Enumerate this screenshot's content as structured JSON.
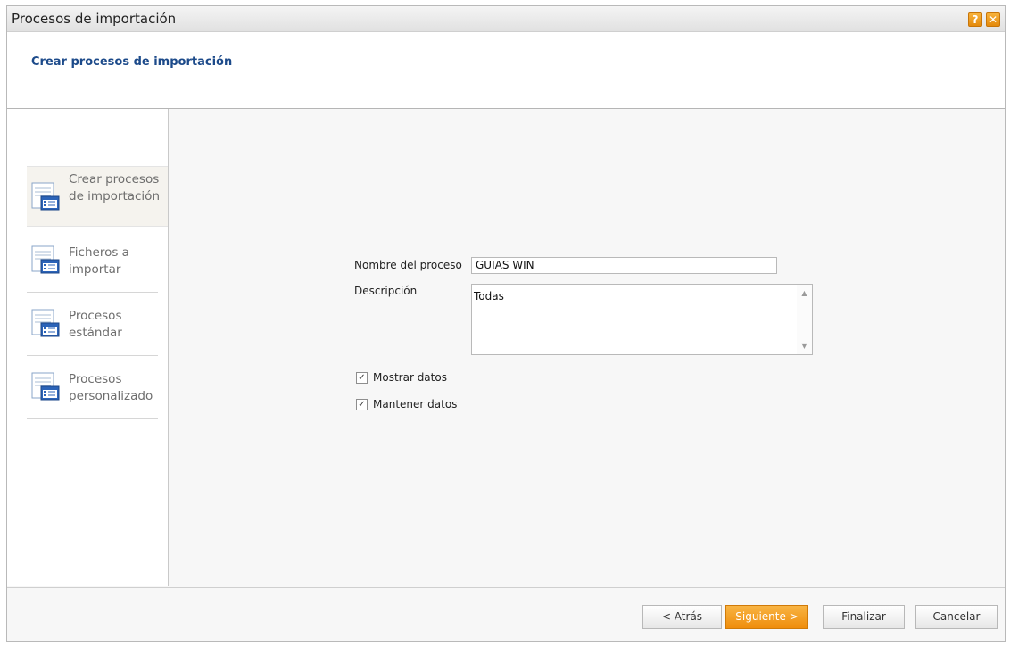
{
  "window": {
    "title": "Procesos de importación",
    "help_icon": "help-icon",
    "close_icon": "close-icon"
  },
  "header": {
    "subtitle": "Crear procesos de importación"
  },
  "sidebar": {
    "items": [
      {
        "label": "Crear procesos de importación",
        "icon": "form-list-icon",
        "active": true
      },
      {
        "label": "Ficheros a importar",
        "icon": "form-list-icon",
        "active": false
      },
      {
        "label": "Procesos estándar",
        "icon": "form-list-icon",
        "active": false
      },
      {
        "label": "Procesos personalizado",
        "icon": "form-list-icon",
        "active": false
      }
    ]
  },
  "form": {
    "name_label": "Nombre del proceso",
    "name_value": "GUIAS WIN",
    "description_label": "Descripción",
    "description_value": "Todas",
    "show_data_label": "Mostrar datos",
    "show_data_checked": true,
    "keep_data_label": "Mantener datos",
    "keep_data_checked": true
  },
  "footer": {
    "back_label": "< Atrás",
    "next_label": "Siguiente >",
    "finish_label": "Finalizar",
    "cancel_label": "Cancelar"
  },
  "colors": {
    "accent_orange": "#ef8d0c",
    "subtitle_blue": "#1c4a8a"
  }
}
